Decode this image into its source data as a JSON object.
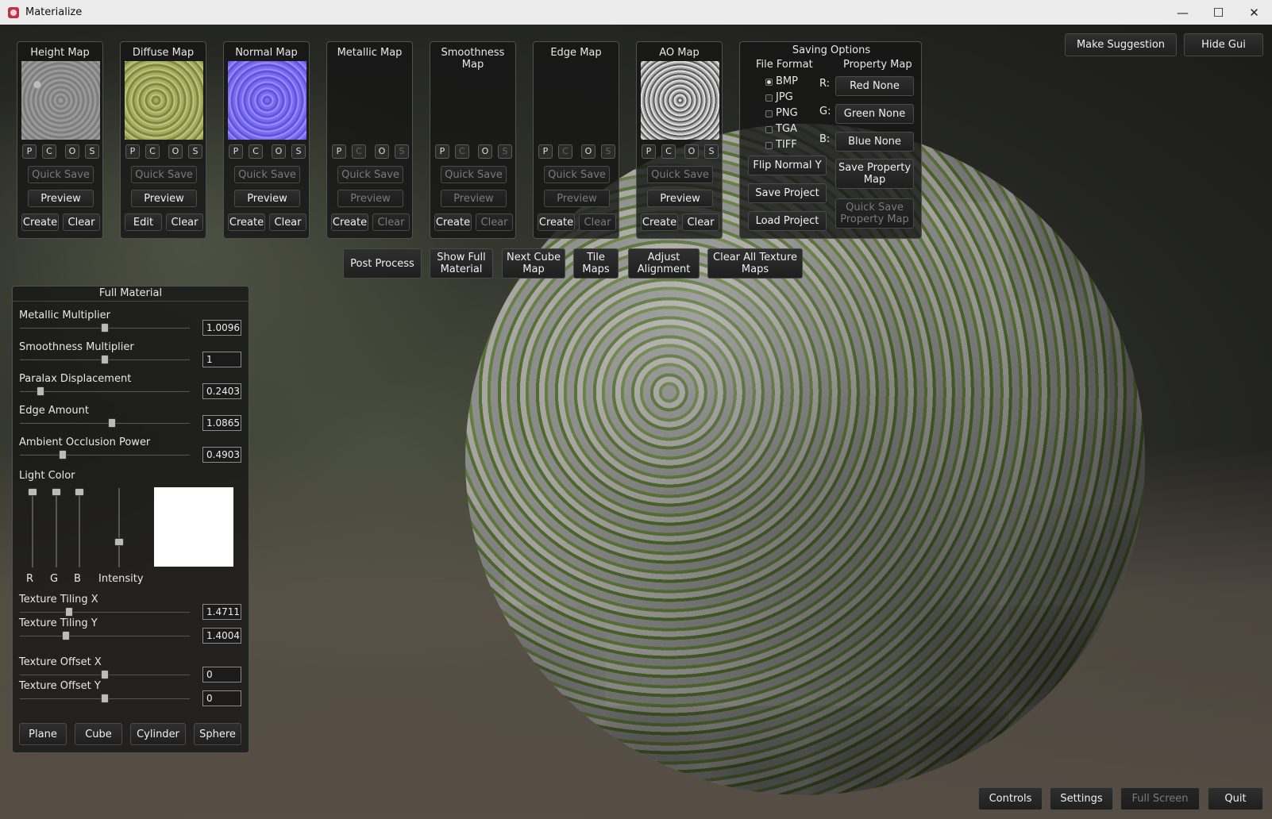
{
  "window": {
    "title": "Materialize",
    "minimize": "—",
    "maximize": "☐",
    "close": "✕"
  },
  "maps": [
    {
      "title": "Height Map",
      "thumb": "height",
      "btns": [
        "P",
        "C",
        "O",
        "S"
      ],
      "quick_save": "Quick Save",
      "preview": "Preview",
      "left_btn": "Create",
      "right_btn": "Clear"
    },
    {
      "title": "Diffuse Map",
      "thumb": "diffuse",
      "btns": [
        "P",
        "C",
        "O",
        "S"
      ],
      "quick_save": "Quick Save",
      "preview": "Preview",
      "left_btn": "Edit",
      "right_btn": "Clear"
    },
    {
      "title": "Normal Map",
      "thumb": "normal",
      "btns": [
        "P",
        "C",
        "O",
        "S"
      ],
      "quick_save": "Quick Save",
      "preview": "Preview",
      "left_btn": "Create",
      "right_btn": "Clear"
    },
    {
      "title": "Metallic Map",
      "thumb": "empty",
      "btns": [
        "P",
        "C",
        "O",
        "S"
      ],
      "quick_save": "Quick Save",
      "preview": "Preview",
      "left_btn": "Create",
      "right_btn": "Clear"
    },
    {
      "title": "Smoothness Map",
      "thumb": "empty",
      "btns": [
        "P",
        "C",
        "O",
        "S"
      ],
      "quick_save": "Quick Save",
      "preview": "Preview",
      "left_btn": "Create",
      "right_btn": "Clear"
    },
    {
      "title": "Edge Map",
      "thumb": "empty",
      "btns": [
        "P",
        "C",
        "O",
        "S"
      ],
      "quick_save": "Quick Save",
      "preview": "Preview",
      "left_btn": "Create",
      "right_btn": "Clear"
    },
    {
      "title": "AO Map",
      "thumb": "ao",
      "btns": [
        "P",
        "C",
        "O",
        "S"
      ],
      "quick_save": "Quick Save",
      "preview": "Preview",
      "left_btn": "Create",
      "right_btn": "Clear"
    }
  ],
  "saving": {
    "title": "Saving Options",
    "file_format_label": "File Format",
    "formats": [
      "BMP",
      "JPG",
      "PNG",
      "TGA",
      "TIFF"
    ],
    "selected": "BMP",
    "property_map_label": "Property Map",
    "r_label": "R:",
    "g_label": "G:",
    "b_label": "B:",
    "red": "Red None",
    "green": "Green None",
    "blue": "Blue None",
    "flip_normal": "Flip Normal Y",
    "save_project": "Save Project",
    "load_project": "Load Project",
    "save_property": "Save Property Map",
    "quick_save_property": "Quick Save Property Map"
  },
  "actions": {
    "post_process": "Post Process",
    "show_full": "Show Full Material",
    "next_cube": "Next Cube Map",
    "tile_maps": "Tile Maps",
    "adjust": "Adjust Alignment",
    "clear_all": "Clear All Texture Maps"
  },
  "top_right": {
    "make_suggestion": "Make Suggestion",
    "hide_gui": "Hide Gui"
  },
  "full_material": {
    "title": "Full Material",
    "sliders": [
      {
        "label": "Metallic Multiplier",
        "value": "1.0096",
        "pos": 0.5
      },
      {
        "label": "Smoothness Multiplier",
        "value": "1",
        "pos": 0.5
      },
      {
        "label": "Paralax Displacement",
        "value": "0.2403",
        "pos": 0.12
      },
      {
        "label": "Edge Amount",
        "value": "1.0865",
        "pos": 0.54
      },
      {
        "label": "Ambient Occlusion Power",
        "value": "0.4903",
        "pos": 0.25
      }
    ],
    "light_color_label": "Light Color",
    "r": "R",
    "g": "G",
    "b": "B",
    "intensity": "Intensity",
    "light_color": "#ffffff",
    "tiling": [
      {
        "label": "Texture Tiling X",
        "value": "1.4711",
        "pos": 0.29
      },
      {
        "label": "Texture Tiling Y",
        "value": "1.4004",
        "pos": 0.27
      }
    ],
    "offset": [
      {
        "label": "Texture Offset X",
        "value": "0",
        "pos": 0.5
      },
      {
        "label": "Texture Offset Y",
        "value": "0",
        "pos": 0.5
      }
    ],
    "shapes": [
      "Plane",
      "Cube",
      "Cylinder",
      "Sphere"
    ]
  },
  "bottom": {
    "controls": "Controls",
    "settings": "Settings",
    "full_screen": "Full Screen",
    "quit": "Quit"
  }
}
